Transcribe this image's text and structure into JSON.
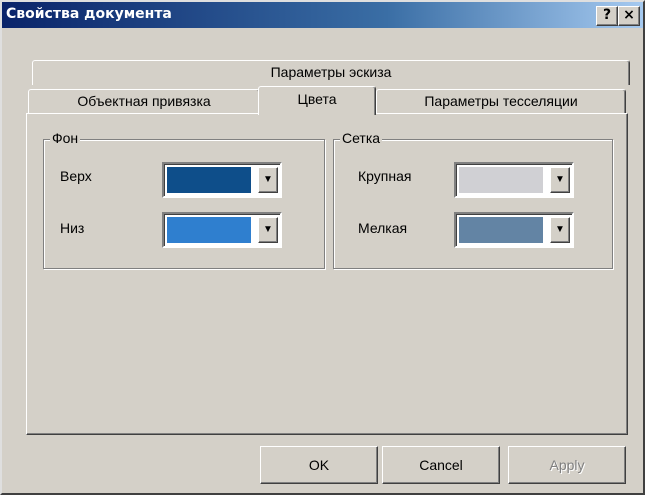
{
  "window": {
    "title": "Свойства документа",
    "help_label": "?",
    "close_label": "×"
  },
  "tabs": {
    "row1": [
      {
        "label": "Параметры эскиза"
      }
    ],
    "row2": [
      {
        "label": "Объектная привязка"
      },
      {
        "label": "Цвета",
        "active": true
      },
      {
        "label": "Параметры тесселяции"
      }
    ]
  },
  "background_group": {
    "legend": "Фон",
    "top": {
      "label": "Верх",
      "color": "#0e4e8a"
    },
    "bottom": {
      "label": "Низ",
      "color": "#2f7fcf"
    }
  },
  "grid_group": {
    "legend": "Сетка",
    "major": {
      "label": "Крупная",
      "color": "#d0d0d4"
    },
    "minor": {
      "label": "Мелкая",
      "color": "#6384a4"
    }
  },
  "buttons": {
    "ok": "OK",
    "cancel": "Cancel",
    "apply": "Apply",
    "apply_enabled": false
  }
}
